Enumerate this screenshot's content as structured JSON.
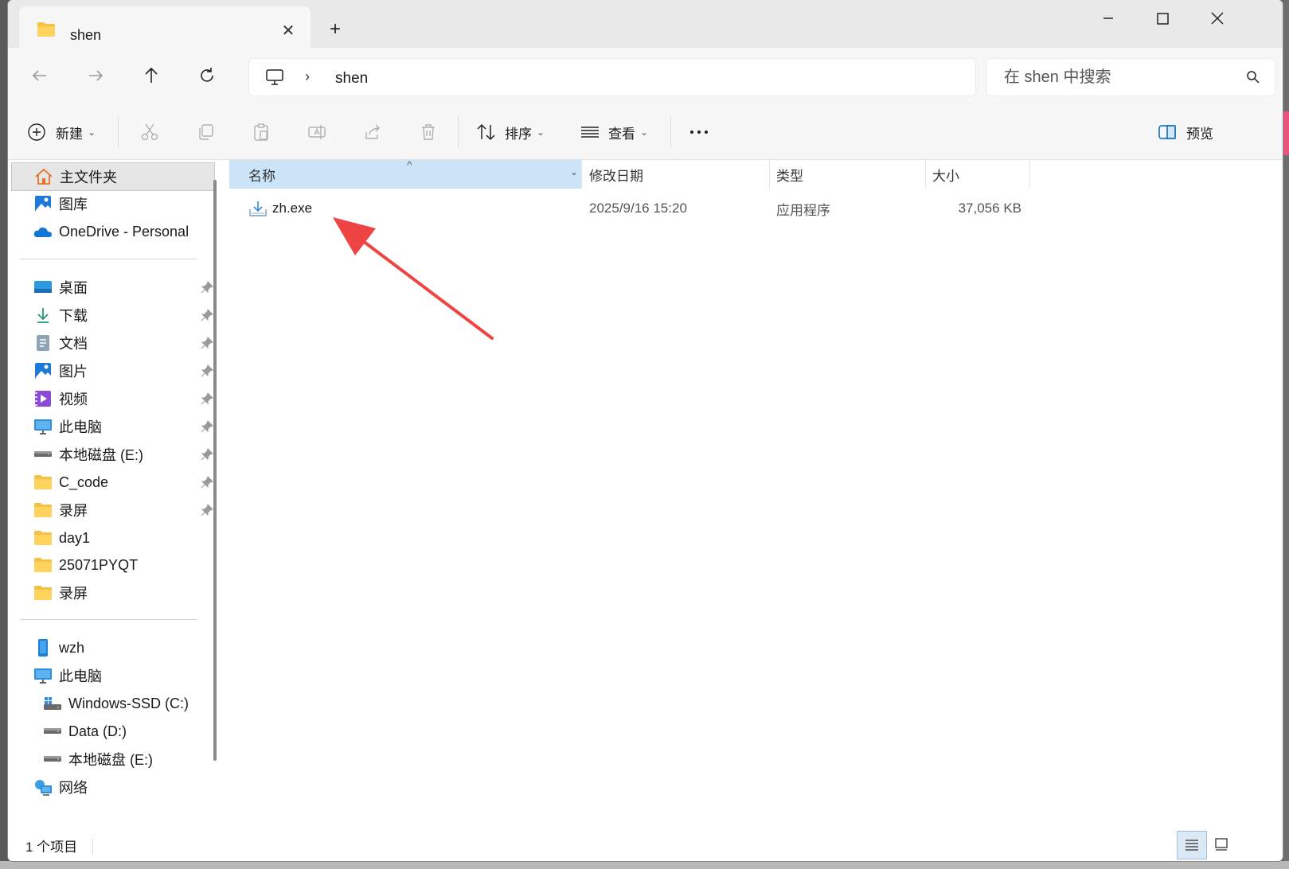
{
  "tab": {
    "title": "shen"
  },
  "address": {
    "path": "shen"
  },
  "search": {
    "placeholder": "在 shen 中搜索"
  },
  "toolbar": {
    "new_label": "新建",
    "sort_label": "排序",
    "view_label": "查看",
    "preview_label": "预览"
  },
  "sidebar": {
    "top": [
      {
        "label": "主文件夹",
        "icon": "home-icon"
      },
      {
        "label": "图库",
        "icon": "gallery-icon"
      },
      {
        "label": "OneDrive - Personal",
        "icon": "onedrive-icon"
      }
    ],
    "quick": [
      {
        "label": "桌面",
        "icon": "desktop-icon"
      },
      {
        "label": "下载",
        "icon": "download-icon"
      },
      {
        "label": "文档",
        "icon": "document-icon"
      },
      {
        "label": "图片",
        "icon": "pictures-icon"
      },
      {
        "label": "视频",
        "icon": "video-icon"
      },
      {
        "label": "此电脑",
        "icon": "computer-icon"
      },
      {
        "label": "本地磁盘 (E:)",
        "icon": "drive-icon"
      },
      {
        "label": "C_code",
        "icon": "folder-icon"
      },
      {
        "label": "录屏",
        "icon": "folder-icon"
      },
      {
        "label": "day1",
        "icon": "folder-icon"
      },
      {
        "label": "25071PYQT",
        "icon": "folder-icon"
      },
      {
        "label": "录屏",
        "icon": "folder-icon"
      }
    ],
    "devices": [
      {
        "label": "wzh",
        "icon": "phone-icon"
      },
      {
        "label": "此电脑",
        "icon": "computer-icon"
      },
      {
        "label": "Windows-SSD (C:)",
        "icon": "windows-drive-icon"
      },
      {
        "label": "Data (D:)",
        "icon": "drive-icon"
      },
      {
        "label": "本地磁盘 (E:)",
        "icon": "drive-icon"
      },
      {
        "label": "网络",
        "icon": "network-icon"
      }
    ]
  },
  "columns": {
    "name": "名称",
    "modified": "修改日期",
    "type": "类型",
    "size": "大小"
  },
  "files": [
    {
      "name": "zh.exe",
      "modified": "2025/9/16 15:20",
      "type": "应用程序",
      "size": "37,056 KB"
    }
  ],
  "status": {
    "count": "1 个项目"
  },
  "colors": {
    "accent": "#0067c0",
    "selection": "#cce4f7",
    "annotation_arrow": "#ee4444"
  }
}
